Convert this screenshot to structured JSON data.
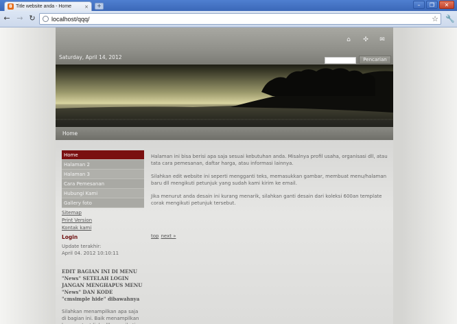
{
  "browser": {
    "tab_title": "Title website anda - Home",
    "tab_close": "×",
    "new_tab": "+",
    "url": "localhost/qqq/",
    "win_min": "–",
    "win_max": "❐",
    "win_close": "✕",
    "icons": {
      "back": "back-arrow-icon",
      "forward": "forward-arrow-icon",
      "reload": "reload-icon",
      "star": "bookmark-star-icon",
      "wrench": "wrench-icon"
    }
  },
  "site": {
    "date": "Saturday, April 14, 2012",
    "search_button": "Pencarian",
    "search_value": "",
    "menu_home": "Home",
    "top_icons": [
      "home-icon",
      "sitemap-icon",
      "mail-icon"
    ]
  },
  "sidebar": {
    "menu": [
      {
        "label": "Home",
        "active": true
      },
      {
        "label": "Halaman 2",
        "active": false
      },
      {
        "label": "Halaman 3",
        "active": false
      },
      {
        "label": "Cara Pemesanan",
        "active": false
      },
      {
        "label": "Hubungi Kami",
        "active": false
      },
      {
        "label": "Gallery foto",
        "active": false
      }
    ],
    "links": [
      "Sitemap",
      "Print Version",
      "Kontak kami"
    ],
    "login": "Login",
    "update_label": "Update terakhir:",
    "update_date": "April 04. 2012 10:10:11",
    "edit_note": "EDIT BAGIAN INI DI MENU \"News\" SETELAH LOGIN JANGAN MENGHAPUS MENU \"News\" DAN KODE \"cmsimple hide\" dibawahnya",
    "side_para": "Silahkan menampilkan apa saja di bagian ini. Baik menampilkan banner, text link, dll mengikuti"
  },
  "content": {
    "paragraphs": [
      "Halaman ini bisa berisi apa saja sesuai kebutuhan anda. Misalnya profil usaha, organisasi dll, atau tata cara pemesanan, daftar harga, atau informasi lainnya.",
      "Silahkan edit website ini seperti mengganti teks, memasukkan gambar, membuat menu/halaman baru dll mengikuti petunjuk yang sudah kami kirim ke email.",
      "Jika menurut anda desain ini kurang menarik, silahkan ganti desain dari koleksi 600an template corak mengikuti petunjuk tersebut."
    ],
    "top_link": "top",
    "next_link": "next »"
  },
  "colors": {
    "accent": "#7a1010",
    "header": "#8f8f89",
    "chrome": "#3b68b8"
  }
}
